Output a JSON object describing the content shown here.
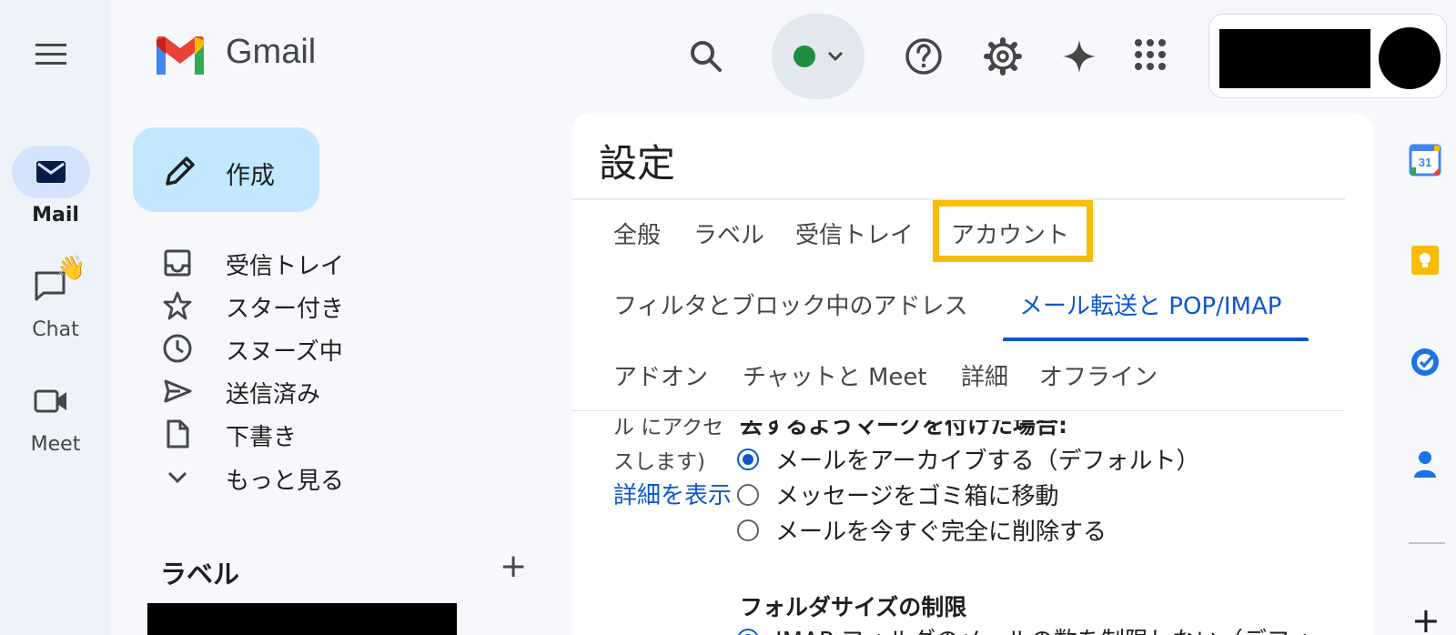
{
  "app": {
    "name": "Gmail",
    "brand_colors": {
      "red": "#ea4335",
      "blue": "#4285f4",
      "green": "#34a853",
      "yellow": "#fbbc04"
    }
  },
  "rail": {
    "items": [
      {
        "label": "Mail",
        "icon": "mail-icon",
        "active": true
      },
      {
        "label": "Chat",
        "icon": "chat-icon",
        "badge": "👋"
      },
      {
        "label": "Meet",
        "icon": "meet-icon"
      }
    ]
  },
  "header": {
    "status_color": "#1e8e3e",
    "icons": [
      "main-menu-icon",
      "search-icon",
      "status-chevron-icon",
      "help-icon",
      "settings-gear-icon",
      "gemini-sparkle-icon",
      "apps-grid-icon"
    ]
  },
  "compose": {
    "label": "作成"
  },
  "nav": {
    "items": [
      {
        "label": "受信トレイ",
        "icon": "inbox-icon"
      },
      {
        "label": "スター付き",
        "icon": "star-icon"
      },
      {
        "label": "スヌーズ中",
        "icon": "clock-icon"
      },
      {
        "label": "送信済み",
        "icon": "send-icon"
      },
      {
        "label": "下書き",
        "icon": "draft-icon"
      },
      {
        "label": "もっと見る",
        "icon": "chevron-down-icon"
      }
    ]
  },
  "labels_section": {
    "title": "ラベル",
    "add": "+"
  },
  "settings": {
    "title": "設定",
    "tabs_row1": [
      "全般",
      "ラベル",
      "受信トレイ",
      "アカウント"
    ],
    "highlighted_tab": "アカウント",
    "tabs_row2": [
      "フィルタとブロック中のアドレス",
      "メール転送と POP/IMAP"
    ],
    "active_tab": "メール転送と POP/IMAP",
    "tabs_row3": [
      "アドオン",
      "チャットと Meet",
      "詳細",
      "オフライン"
    ],
    "content": {
      "side_text_1": "ル にアクセ",
      "side_text_2": "スします)",
      "side_link": "詳細を表示",
      "cut_heading": "去するようマークを付けた場合:",
      "radios": [
        {
          "label": "メールをアーカイブする（デフォルト）",
          "selected": true
        },
        {
          "label": "メッセージをゴミ箱に移動",
          "selected": false
        },
        {
          "label": "メールを今すぐ完全に削除する",
          "selected": false
        }
      ],
      "section_title": "フォルダサイズの制限",
      "partial_option": "IMAP フォルダのメールの数を制限しない（デフォ"
    }
  },
  "side_apps": [
    "calendar-icon",
    "keep-icon",
    "tasks-icon",
    "contacts-icon",
    "add-icon"
  ],
  "side_apps_calendar_day": "31",
  "side_add": "+"
}
